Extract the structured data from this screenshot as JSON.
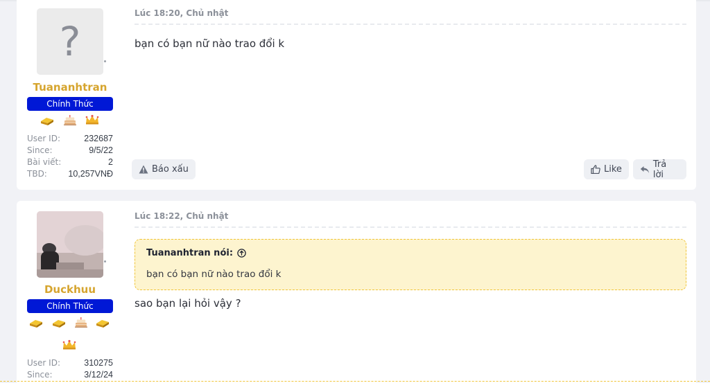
{
  "posts": [
    {
      "time": "Lúc 18:20, Chủ nhật",
      "user": {
        "name": "Tuananhtran",
        "rank": "Chính Thức",
        "avatar_placeholder": "?",
        "stats": [
          {
            "label": "User ID:",
            "value": "232687"
          },
          {
            "label": "Since:",
            "value": "9/5/22"
          },
          {
            "label": "Bài viết:",
            "value": "2"
          },
          {
            "label": "TBD:",
            "value": "10,257VNĐ"
          }
        ],
        "trophies": [
          "gold-bar-icon",
          "cake-icon",
          "crown-icon"
        ]
      },
      "body": "bạn có bạn nữ nào trao đổi k",
      "actions": {
        "report": "Báo xấu",
        "like": "Like",
        "reply": "Trả lời"
      }
    },
    {
      "time": "Lúc 18:22, Chủ nhật",
      "user": {
        "name": "Duckhuu",
        "rank": "Chính Thức",
        "stats": [
          {
            "label": "User ID:",
            "value": "310275"
          },
          {
            "label": "Since:",
            "value": "3/12/24"
          }
        ],
        "trophies": [
          "gold-bar-icon",
          "gold-bar-icon",
          "cake-icon",
          "gold-bar-icon",
          "crown-icon"
        ]
      },
      "quote": {
        "author": "Tuananhtran nói:",
        "text": "bạn có bạn nữ nào trao đổi k"
      },
      "body": "sao bạn lại hỏi vậy ?"
    }
  ],
  "colors": {
    "page_bg": "#f1f2f6",
    "username": "#d6a52f",
    "rank_badge": "#0018d6",
    "quote_bg": "#fdf4cf",
    "quote_border": "#f0c437"
  }
}
